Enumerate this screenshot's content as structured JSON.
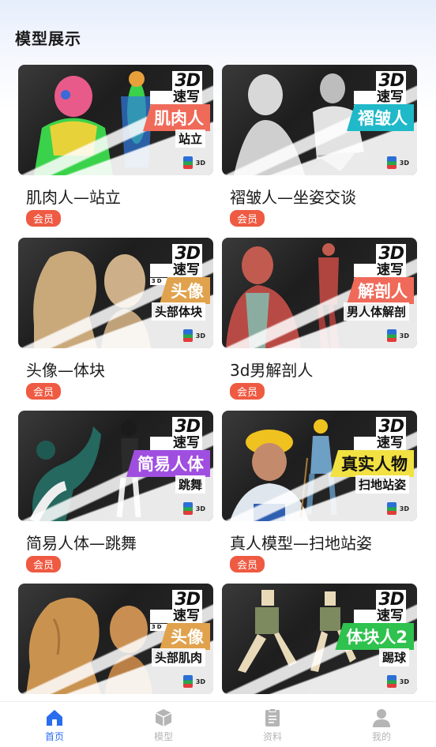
{
  "section": {
    "title": "模型展示"
  },
  "logo": {
    "big": "3D",
    "zh": "速写",
    "en": "3D SKETCH"
  },
  "models": [
    {
      "title": "肌肉人—站立",
      "badge": "会员",
      "tag_main": "肌肉人",
      "tag_sub": "站立",
      "tag_color": "#f06a5a",
      "figure": "muscle"
    },
    {
      "title": "褶皱人—坐姿交谈",
      "badge": "会员",
      "tag_main": "褶皱人",
      "tag_sub": "",
      "tag_color": "#1fb9c9",
      "figure": "wrinkle"
    },
    {
      "title": "头像—体块",
      "badge": "会员",
      "tag_main": "头像",
      "tag_sub": "头部体块",
      "tag_color": "#e0a24c",
      "figure": "head"
    },
    {
      "title": "3d男解剖人",
      "badge": "会员",
      "tag_main": "解剖人",
      "tag_sub": "男人体解剖",
      "tag_color": "#f06a5a",
      "figure": "anatomy"
    },
    {
      "title": "简易人体—跳舞",
      "badge": "会员",
      "tag_main": "简易人体",
      "tag_sub": "跳舞",
      "tag_color": "#a04ee0",
      "figure": "dance"
    },
    {
      "title": "真人模型—扫地站姿",
      "badge": "会员",
      "tag_main": "真实人物",
      "tag_sub": "扫地站姿",
      "tag_color": "#f2e142",
      "figure": "worker"
    },
    {
      "title": "",
      "badge": "",
      "tag_main": "头像",
      "tag_sub": "头部肌肉",
      "tag_color": "#e0a24c",
      "figure": "headmuscle"
    },
    {
      "title": "",
      "badge": "",
      "tag_main": "体块人2",
      "tag_sub": "踢球",
      "tag_color": "#2fc24e",
      "figure": "block"
    }
  ],
  "tabbar": {
    "items": [
      {
        "label": "首页",
        "icon": "home-icon",
        "active": true
      },
      {
        "label": "模型",
        "icon": "cube-icon",
        "active": false
      },
      {
        "label": "资料",
        "icon": "document-icon",
        "active": false
      },
      {
        "label": "我的",
        "icon": "user-icon",
        "active": false
      }
    ],
    "active_color": "#2a6cf0",
    "inactive_color": "#b5b5b5"
  }
}
